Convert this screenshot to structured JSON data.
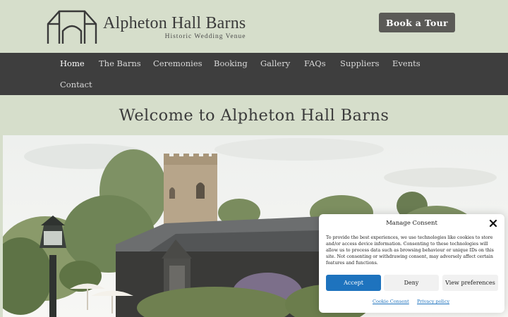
{
  "brand": {
    "title": "Alpheton Hall Barns",
    "subtitle": "Historic Wedding Venue",
    "logo_icon": "barn-outline-logo"
  },
  "header": {
    "book_label": "Book a Tour",
    "book_color": "#5b5a57",
    "background": "#d6decb"
  },
  "nav": {
    "items": [
      {
        "label": "Home",
        "active": true
      },
      {
        "label": "The Barns"
      },
      {
        "label": "Ceremonies"
      },
      {
        "label": "Booking"
      },
      {
        "label": "Gallery"
      },
      {
        "label": "FAQs"
      },
      {
        "label": "Suppliers"
      },
      {
        "label": "Events"
      },
      {
        "label": "Contact"
      }
    ],
    "background": "#3e3e3e"
  },
  "page": {
    "heading": "Welcome to Alpheton Hall Barns"
  },
  "consent": {
    "title": "Manage Consent",
    "body": "To provide the best experiences, we use technologies like cookies to store and/or access device information. Consenting to these technologies will allow us to process data such as browsing behaviour or unique IDs on this site. Not consenting or withdrawing consent, may adversely affect certain features and functions.",
    "accept_label": "Accept",
    "deny_label": "Deny",
    "preferences_label": "View preferences",
    "cookie_policy_label": "Cookie Consent",
    "privacy_policy_label": "Privacy policy",
    "accent": "#1e73be",
    "close_icon": "close-icon"
  }
}
